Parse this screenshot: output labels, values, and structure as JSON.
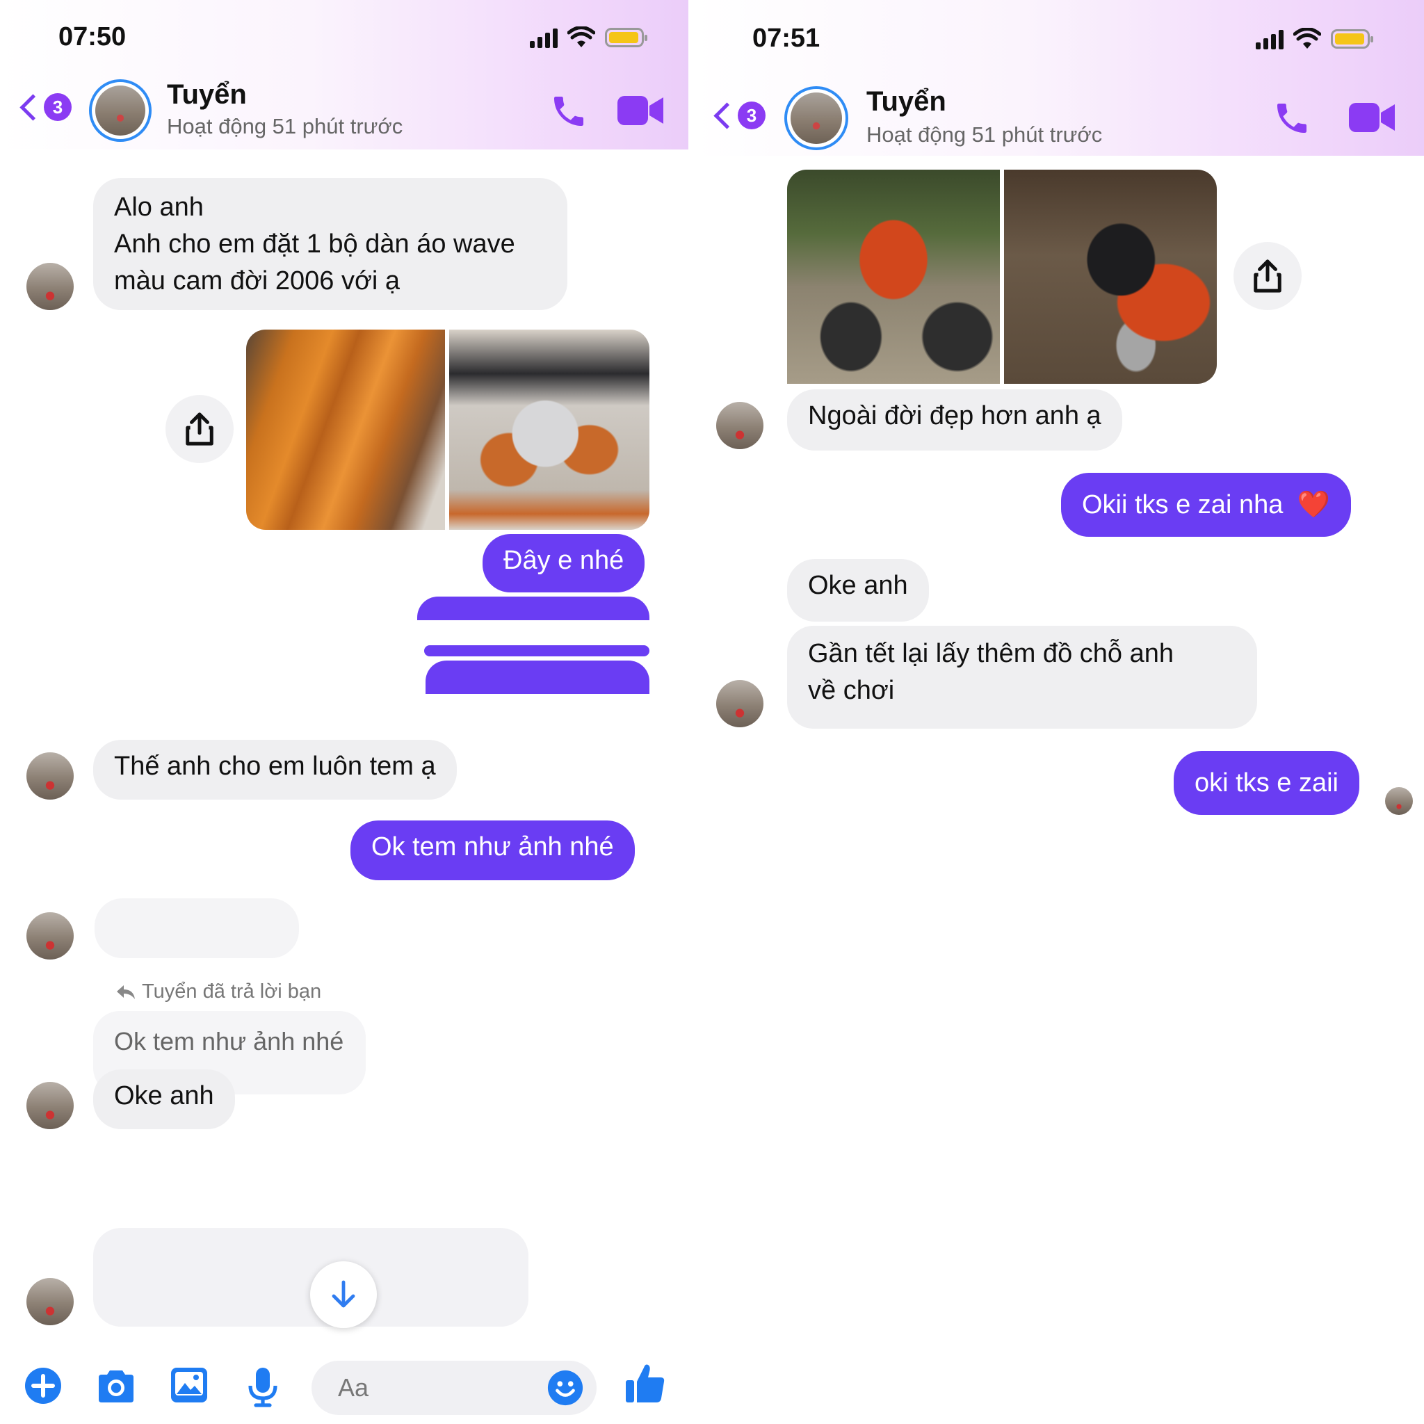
{
  "colors": {
    "accent": "#6a3df3",
    "header_icon": "#8b3bf3",
    "incoming_bubble": "#efeff1"
  },
  "left": {
    "status_time": "07:50",
    "header": {
      "back_badge": "3",
      "name": "Tuyển",
      "subtitle": "Hoạt động 51 phút trước",
      "icons": [
        "back-chevron-icon",
        "phone-icon",
        "video-camera-icon"
      ]
    },
    "messages": {
      "m1_line1": "Alo anh",
      "m1_line2": "Anh cho em đặt 1 bộ dàn áo wave",
      "m1_line3": "màu cam đời 2006 với ạ",
      "m2": "Đây e nhé",
      "m3": "Thế anh cho em luôn tem ạ",
      "m4": "Ok tem như ảnh nhé",
      "reply_note": "Tuyển đã trả lời bạn",
      "quoted": "Ok tem như ảnh nhé",
      "m5": "Oke anh"
    },
    "composer": {
      "placeholder": "Aa",
      "icons": [
        "plus-icon",
        "camera-icon",
        "gallery-icon",
        "microphone-icon",
        "emoji-icon",
        "thumbs-up-icon"
      ]
    }
  },
  "right": {
    "status_time": "07:51",
    "header": {
      "back_badge": "3",
      "name": "Tuyển",
      "subtitle": "Hoạt động 51 phút trước"
    },
    "messages": {
      "m1": "Ngoài đời đẹp hơn anh ạ",
      "m2": "Okii tks e zai nha",
      "m2_emoji": "❤️",
      "m3": "Oke anh",
      "m4_line1": "Gần tết lại lấy thêm đồ chỗ anh",
      "m4_line2": "về chơi",
      "m5": "oki tks e zaii"
    }
  }
}
